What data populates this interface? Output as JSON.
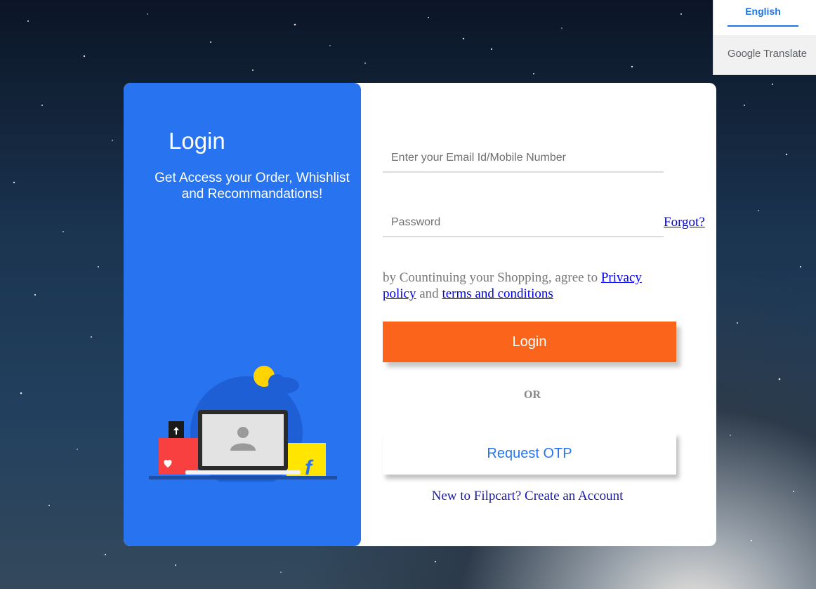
{
  "translate": {
    "language": "English",
    "brand_google": "Google",
    "brand_translate": "Translate"
  },
  "panel": {
    "title": "Login",
    "subtitle": "Get Access your Order, Whishlist and Recommandations!"
  },
  "form": {
    "email_placeholder": "Enter your Email Id/Mobile Number",
    "password_placeholder": "Password",
    "forgot_label": "Forgot?",
    "terms_prefix": "by Countinuing your Shopping, agree to",
    "privacy_link": "Privacy policy",
    "terms_and": "and",
    "terms_link": "terms and conditions",
    "login_label": "Login",
    "or_label": "OR",
    "otp_label": "Request OTP",
    "create_label": "New to Filpcart? Create an Account"
  },
  "colors": {
    "panel_blue": "#2874f0",
    "login_orange": "#fb641b",
    "link_blue": "#0000ee"
  }
}
